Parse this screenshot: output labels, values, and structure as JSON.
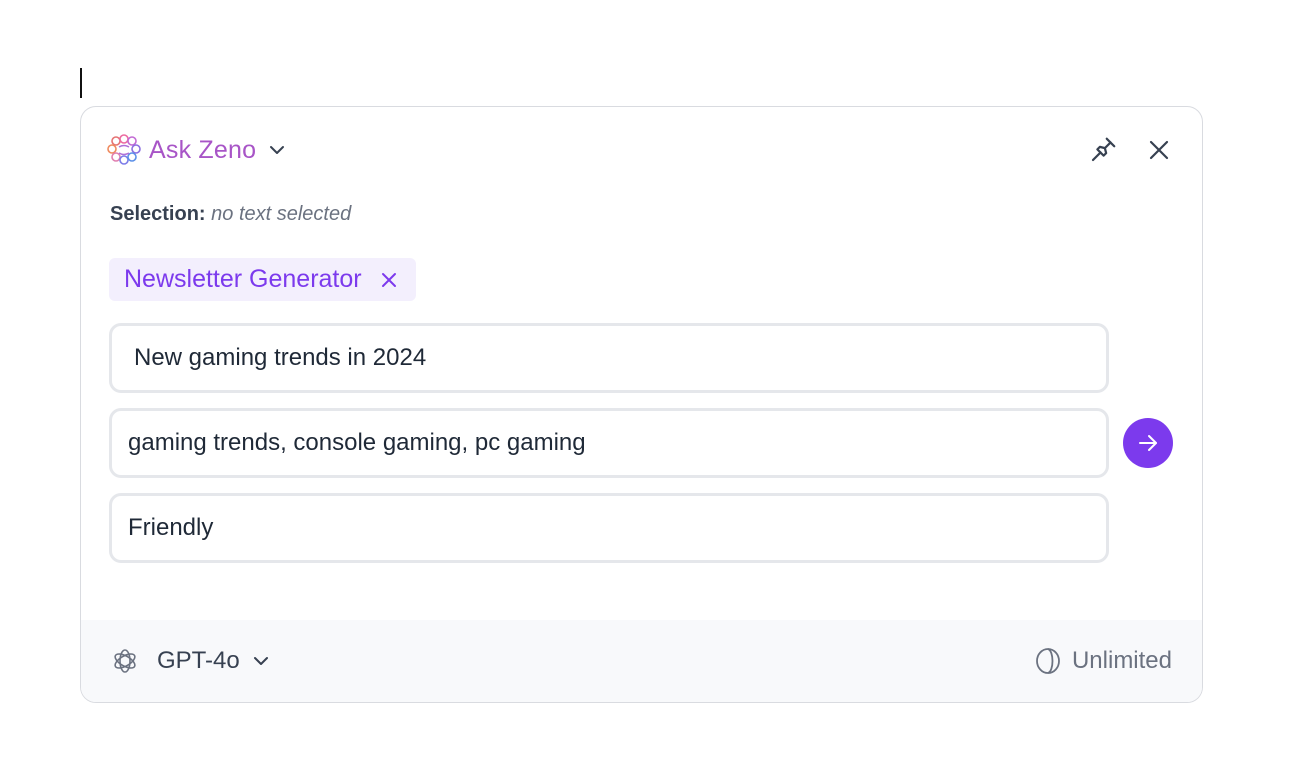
{
  "header": {
    "brand_name": "Ask Zeno",
    "icons": [
      "brain-logo-icon",
      "chevron-down-icon",
      "pin-icon",
      "close-icon"
    ]
  },
  "selection": {
    "label": "Selection:",
    "value": "no text selected"
  },
  "chip": {
    "label": "Newsletter Generator"
  },
  "fields": {
    "topic": "New gaming trends in 2024",
    "keywords": "gaming trends, console gaming, pc gaming",
    "tone": "Friendly"
  },
  "footer": {
    "model_name": "GPT-4o",
    "credits": "Unlimited"
  },
  "colors": {
    "accent": "#7c3aed",
    "brand_text": "#a855c7",
    "chip_bg": "#f3effd",
    "footer_bg": "#f8f9fb"
  }
}
